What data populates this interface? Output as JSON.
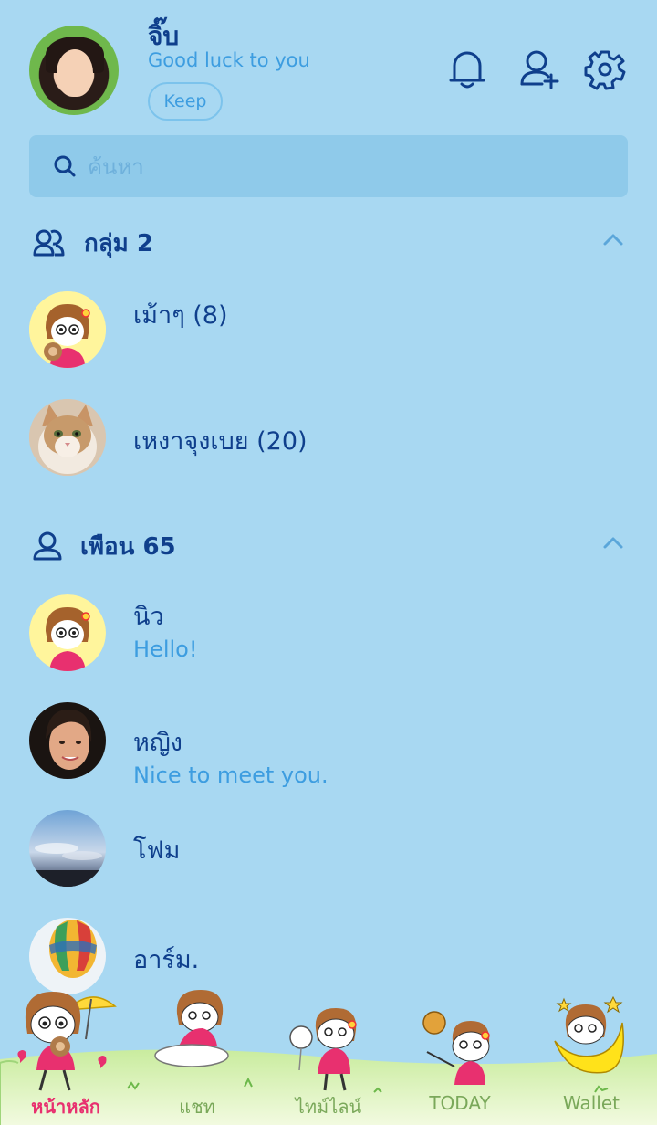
{
  "profile": {
    "name": "จิ๊บ",
    "status": "Good luck to you",
    "keep_label": "Keep"
  },
  "search": {
    "placeholder": "ค้นหา"
  },
  "groups_section": {
    "title": "กลุ่ม 2",
    "items": [
      {
        "name": "เม้าๆ (8)",
        "avatar": "cartoon-girl-teddy"
      },
      {
        "name": "เหงาจุงเบย (20)",
        "avatar": "cat-photo"
      }
    ]
  },
  "friends_section": {
    "title": "เพือน 65",
    "items": [
      {
        "name": "นิว",
        "message": "Hello!",
        "avatar": "cartoon-girl"
      },
      {
        "name": "หญิง",
        "message": "Nice to meet you.",
        "avatar": "woman-photo"
      },
      {
        "name": "โฟม",
        "message": "",
        "avatar": "sky-photo"
      },
      {
        "name": "อาร์ม.",
        "message": "",
        "avatar": "balloon-photo"
      }
    ]
  },
  "bottom_nav": [
    {
      "label": "หน้าหลัก",
      "active": true
    },
    {
      "label": "แชท",
      "active": false
    },
    {
      "label": "ไทม์ไลน์",
      "active": false
    },
    {
      "label": "TODAY",
      "active": false
    },
    {
      "label": "Wallet",
      "active": false
    }
  ],
  "colors": {
    "background": "#a8d8f2",
    "primary_text": "#0f3f8c",
    "secondary_text": "#3d9de0",
    "active_nav": "#e8306f",
    "inactive_nav": "#7aa85a"
  }
}
